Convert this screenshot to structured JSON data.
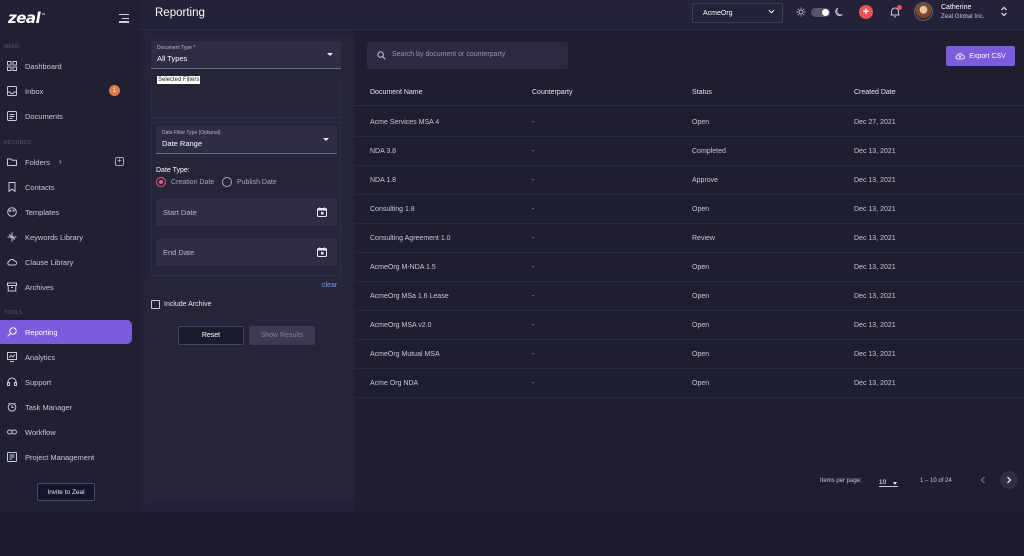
{
  "brand": {
    "name": "zeal",
    "mark": "™",
    "accent": "#7a5cdc"
  },
  "sidebar": {
    "sections": {
      "menu": "MENU",
      "records": "RECORDS",
      "tools": "TOOLS"
    },
    "items": [
      {
        "label": "Dashboard",
        "icon": "grid-icon"
      },
      {
        "label": "Inbox",
        "icon": "inbox-icon",
        "badge": "1"
      },
      {
        "label": "Documents",
        "icon": "document-icon"
      },
      {
        "label": "Folders",
        "icon": "folder-icon"
      },
      {
        "label": "Contacts",
        "icon": "bookmark-icon"
      },
      {
        "label": "Templates",
        "icon": "palette-icon"
      },
      {
        "label": "Keywords Library",
        "icon": "keyword-icon"
      },
      {
        "label": "Clause Library",
        "icon": "cloud-icon"
      },
      {
        "label": "Archives",
        "icon": "archive-icon"
      },
      {
        "label": "Reporting",
        "icon": "report-icon",
        "active": true
      },
      {
        "label": "Analytics",
        "icon": "analytics-icon"
      },
      {
        "label": "Support",
        "icon": "headset-icon"
      },
      {
        "label": "Task Manager",
        "icon": "clock-icon"
      },
      {
        "label": "Workflow",
        "icon": "link-icon"
      },
      {
        "label": "Project Management",
        "icon": "project-icon"
      }
    ],
    "invite_label": "Invite to Zeal"
  },
  "header": {
    "title": "Reporting",
    "org": "AcmeOrg",
    "user_name": "Catherine",
    "user_org": "Zeal Global Inc."
  },
  "filters": {
    "doc_type_label": "Document Type *",
    "doc_type_value": "All Types",
    "selected_filters_label": "Selected Filters",
    "date_filter_label": "Date Filter Type (Optional)",
    "date_filter_value": "Date Range",
    "date_type_label": "Date Type:",
    "radio_creation": "Creation Date",
    "radio_publish": "Publish Date",
    "start_date_placeholder": "Start Date",
    "end_date_placeholder": "End Date",
    "clear_label": "clear",
    "include_archive_label": "Include Archive",
    "reset_label": "Reset",
    "show_results_label": "Show Results"
  },
  "main": {
    "search_placeholder": "Search by document or counterparty",
    "export_label": "Export CSV",
    "columns": [
      "Document Name",
      "Counterparty",
      "Status",
      "Created Date"
    ],
    "rows": [
      [
        "Acme Services MSA 4",
        "-",
        "Open",
        "Dec 27, 2021"
      ],
      [
        "NDA 3.8",
        "-",
        "Completed",
        "Dec 13, 2021"
      ],
      [
        "NDA 1.8",
        "-",
        "Approve",
        "Dec 13, 2021"
      ],
      [
        "Consulting 1.8",
        "-",
        "Open",
        "Dec 13, 2021"
      ],
      [
        "Consulting Agreement 1.0",
        "-",
        "Review",
        "Dec 13, 2021"
      ],
      [
        "AcmeOrg M-NDA 1.5",
        "-",
        "Open",
        "Dec 13, 2021"
      ],
      [
        "AcmeOrg MSa 1.6 Lease",
        "-",
        "Open",
        "Dec 13, 2021"
      ],
      [
        "AcmeOrg MSA v2.0",
        "-",
        "Open",
        "Dec 13, 2021"
      ],
      [
        "AcmeOrg Mutual MSA",
        "-",
        "Open",
        "Dec 13, 2021"
      ],
      [
        "Acme Org NDA",
        "-",
        "Open",
        "Dec 13, 2021"
      ]
    ],
    "items_per_page_label": "Items per page:",
    "items_per_page_value": "10",
    "range_text": "1 – 10 of 24"
  }
}
